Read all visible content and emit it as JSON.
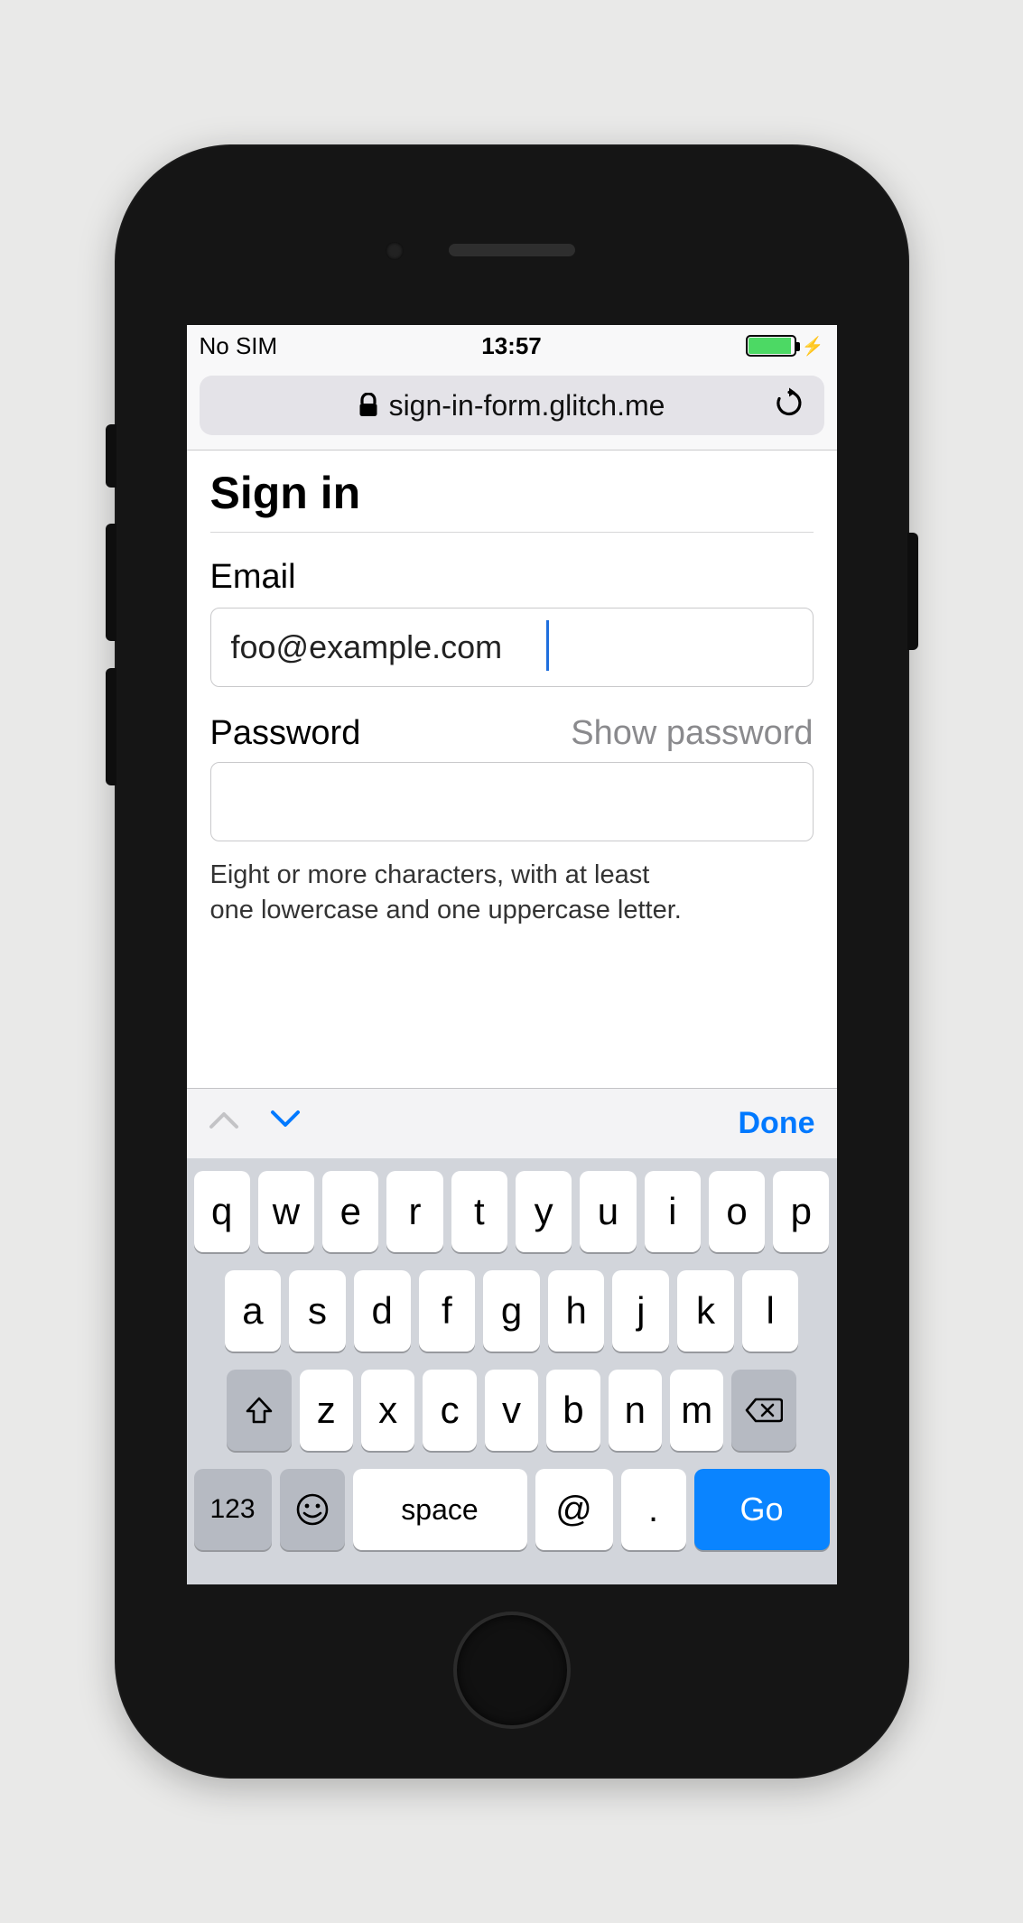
{
  "status_bar": {
    "carrier": "No SIM",
    "time": "13:57"
  },
  "url_bar": {
    "host": "sign-in-form.glitch.me"
  },
  "page": {
    "title": "Sign in",
    "email_label": "Email",
    "email_value": "foo@example.com",
    "password_label": "Password",
    "show_password": "Show password",
    "password_value": "",
    "hint_line1": "Eight or more characters, with at least",
    "hint_line2": "one lowercase and one uppercase letter."
  },
  "accessory": {
    "done": "Done"
  },
  "keyboard": {
    "row1": [
      "q",
      "w",
      "e",
      "r",
      "t",
      "y",
      "u",
      "i",
      "o",
      "p"
    ],
    "row2": [
      "a",
      "s",
      "d",
      "f",
      "g",
      "h",
      "j",
      "k",
      "l"
    ],
    "row3": [
      "z",
      "x",
      "c",
      "v",
      "b",
      "n",
      "m"
    ],
    "k123": "123",
    "space": "space",
    "at": "@",
    "dot": ".",
    "go": "Go"
  }
}
